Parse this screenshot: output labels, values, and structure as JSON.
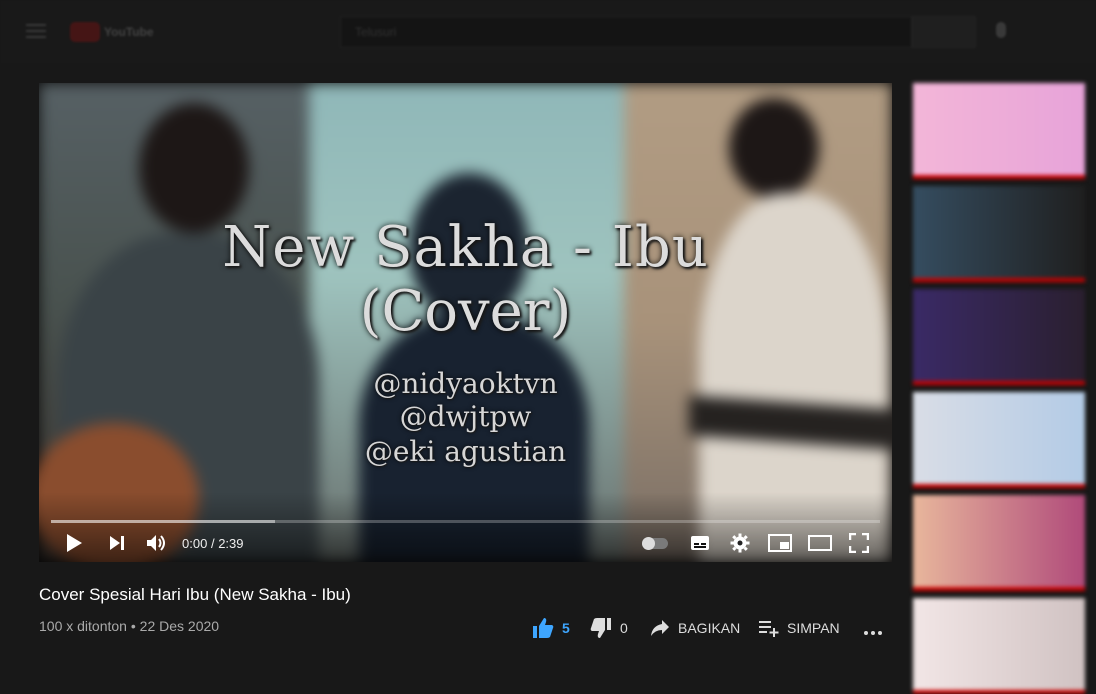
{
  "topbar": {
    "logo_text": "YouTube",
    "search_placeholder": "Telusuri"
  },
  "player": {
    "overlay_title_line1": "New Sakha - Ibu",
    "overlay_title_line2": "(Cover)",
    "handles": [
      "@nidyaoktvn",
      "@dwjtpw",
      "@eki agustian"
    ],
    "time_current": "0:00",
    "time_separator": "/",
    "time_total": "2:39",
    "buffered_fraction": 0.27
  },
  "video": {
    "title": "Cover Spesial Hari Ibu (New Sakha - Ibu)",
    "views": "100 x ditonton",
    "date_separator": "•",
    "date": "22 Des 2020"
  },
  "actions": {
    "likes": "5",
    "dislikes": "0",
    "share_label": "BAGIKAN",
    "save_label": "SIMPAN"
  },
  "colors": {
    "background": "#181818",
    "accent_like": "#3ea6ff",
    "progress_red": "#cc0000"
  },
  "sidebar": {
    "thumbnails": [
      {
        "colors": [
          "#f3b6d8",
          "#e7a3d9"
        ]
      },
      {
        "colors": [
          "#354d60",
          "#1f1f1f"
        ]
      },
      {
        "colors": [
          "#3a2a66",
          "#2a1f2f"
        ]
      },
      {
        "colors": [
          "#d9dde6",
          "#b3cbe6"
        ]
      },
      {
        "colors": [
          "#e8b79c",
          "#b04a7a"
        ]
      },
      {
        "colors": [
          "#f2e6e6",
          "#d0c2c2"
        ]
      }
    ]
  }
}
